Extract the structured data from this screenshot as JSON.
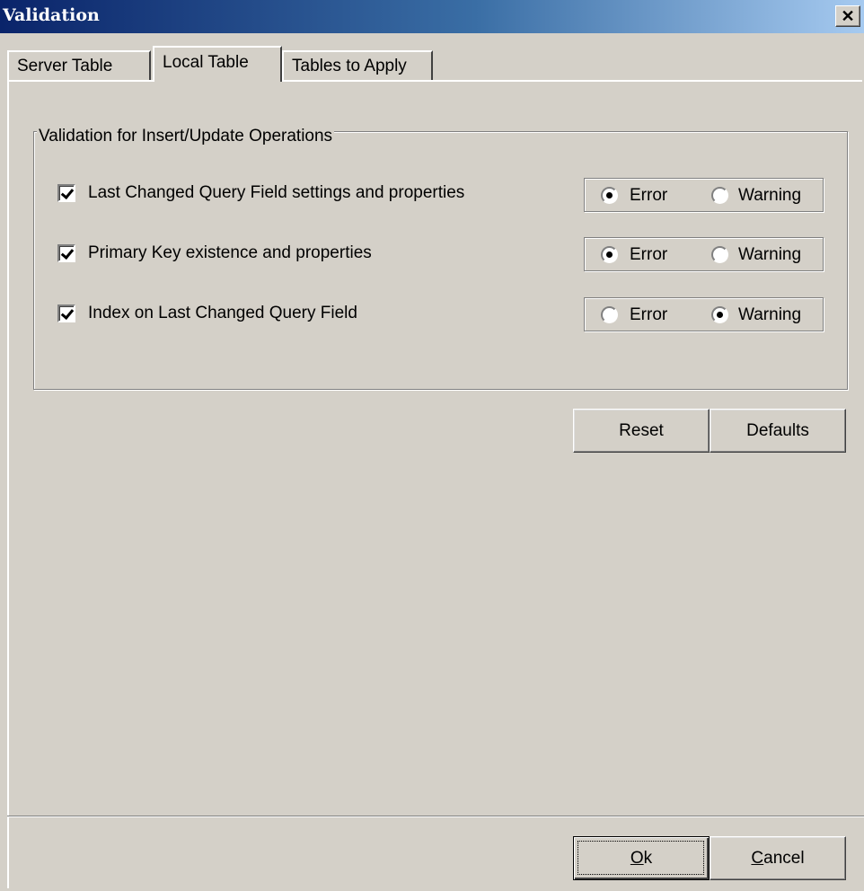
{
  "window": {
    "title": "Validation",
    "close_glyph": "✕"
  },
  "tabs": [
    {
      "label": "Server Table",
      "active": false
    },
    {
      "label": "Local Table",
      "active": true
    },
    {
      "label": "Tables to Apply",
      "active": false
    }
  ],
  "group": {
    "legend": "Validation for Insert/Update Operations",
    "rows": [
      {
        "label": "Last Changed Query Field settings and properties",
        "checked": true,
        "error_label": "Error",
        "warning_label": "Warning",
        "severity": "Error"
      },
      {
        "label": "Primary Key existence and properties",
        "checked": true,
        "error_label": "Error",
        "warning_label": "Warning",
        "severity": "Error"
      },
      {
        "label": "Index on Last Changed Query Field",
        "checked": true,
        "error_label": "Error",
        "warning_label": "Warning",
        "severity": "Warning"
      }
    ]
  },
  "buttons": {
    "reset": "Reset",
    "defaults": "Defaults",
    "ok_mnemonic": "O",
    "ok_rest": "k",
    "cancel_mnemonic": "C",
    "cancel_rest": "ancel"
  },
  "colors": {
    "face": "#d4d0c8",
    "title_start": "#0a246a",
    "title_end": "#a6caf0"
  }
}
